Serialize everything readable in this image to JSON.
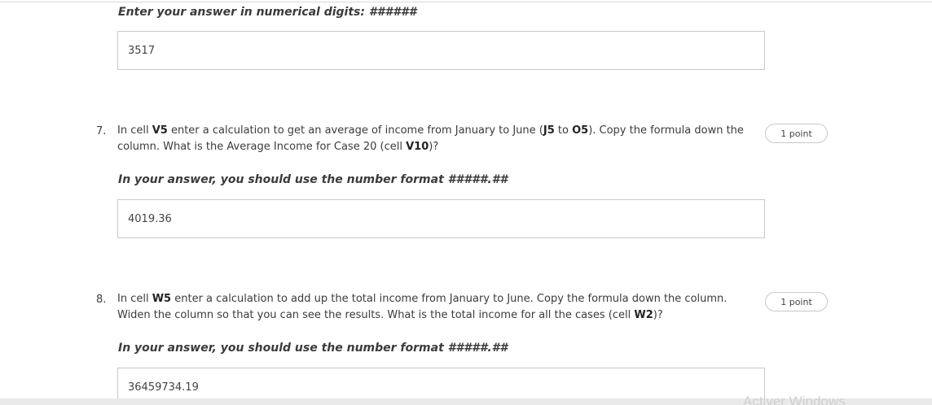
{
  "q6": {
    "instruction": "Enter your answer in numerical digits: ######",
    "answer": "3517"
  },
  "q7": {
    "number": "7.",
    "text_parts": [
      "In cell ",
      "V5",
      " enter a calculation to get an average of income from January to June (",
      "J5",
      " to ",
      "O5",
      "). Copy the formula down the column. What is the Average Income for Case 20 (cell ",
      "V10",
      ")?"
    ],
    "points": "1 point",
    "instruction": "In your answer, you should use the number format #####.##",
    "answer": "4019.36"
  },
  "q8": {
    "number": "8.",
    "text_parts": [
      "In cell ",
      "W5",
      " enter a calculation to add up the total income from January to June. Copy the formula down the column. Widen the column so that you can see the results. What is the total income for all the cases (cell ",
      "W2",
      ")?"
    ],
    "points": "1 point",
    "instruction": "In your answer, you should use the number format #####.##",
    "answer": "36459734.19"
  },
  "watermark": "Activer Windows"
}
